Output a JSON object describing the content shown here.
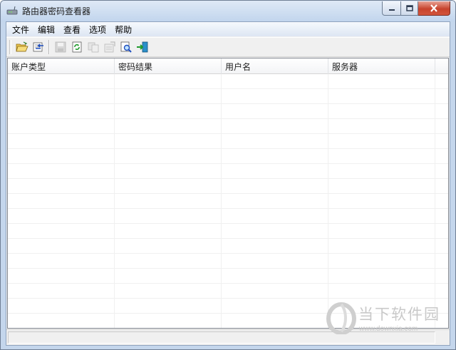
{
  "window": {
    "title": "路由器密码查看器"
  },
  "menu": {
    "items": [
      {
        "label": "文件"
      },
      {
        "label": "编辑"
      },
      {
        "label": "查看"
      },
      {
        "label": "选项"
      },
      {
        "label": "帮助"
      }
    ]
  },
  "toolbar": {
    "buttons": [
      {
        "icon": "open-folder-icon",
        "enabled": true
      },
      {
        "icon": "import-icon",
        "enabled": true
      },
      {
        "icon": "save-icon",
        "enabled": false
      },
      {
        "icon": "refresh-icon",
        "enabled": true
      },
      {
        "icon": "copy-icon",
        "enabled": false
      },
      {
        "icon": "properties-icon",
        "enabled": false
      },
      {
        "icon": "find-icon",
        "enabled": true
      },
      {
        "icon": "exit-icon",
        "enabled": true
      }
    ]
  },
  "table": {
    "columns": [
      {
        "label": "账户类型"
      },
      {
        "label": "密码结果"
      },
      {
        "label": "用户名"
      },
      {
        "label": "服务器"
      }
    ],
    "rows": []
  },
  "watermark": {
    "brand": "当下软件园",
    "url": "www.downxia.com"
  },
  "colors": {
    "frame": "#c4d6ec",
    "close_button": "#c7432c",
    "watermark": "#c9c9c9"
  }
}
